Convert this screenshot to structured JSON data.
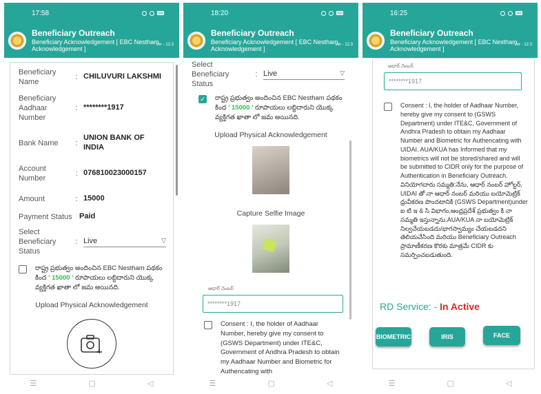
{
  "header": {
    "title": "Beneficiary Outreach",
    "subtitle_line1": "Beneficiary Acknowledgement [ EBC Nestham",
    "subtitle_line2": "Acknowledgement ]",
    "version": "Ver - 12.3"
  },
  "colors": {
    "accent": "#26a699",
    "amount": "#30c04e",
    "inactive": "#d12a2a"
  },
  "icons": [
    "status-icons",
    "camera-icon",
    "checkbox-icon",
    "dropdown-chevron-icon",
    "menu-nav-icon",
    "home-nav-icon",
    "back-nav-icon"
  ],
  "screen1": {
    "time": "17:58",
    "fields": [
      {
        "label": "Beneficiary Name",
        "value": "CHILUVURI LAKSHMI"
      },
      {
        "label": "Beneficiary Aadhaar Number",
        "value": "********1917"
      },
      {
        "label": "Bank Name",
        "value": "UNION BANK OF INDIA"
      },
      {
        "label": "Account Number",
        "value": "076810023000157"
      },
      {
        "label": "Amount",
        "value": "15000"
      },
      {
        "label": "Payment Status",
        "value": "Paid"
      }
    ],
    "select_label": "Select Beneficiary Status",
    "select_value": "Live",
    "consent_pre": "రాష్ట్ర ప్రభుత్వం అందించిన EBC Nestham పథకం కింద",
    "consent_amount": "' 15000 '",
    "consent_post": "రూపాయలు లబ్దిదారుని యొక్క వ్యక్తిగత ఖాతా లో జమ అయినది.",
    "upload_title": "Upload Physical Acknowledgement"
  },
  "screen2": {
    "time": "18:20",
    "select_label": "Select Beneficiary Status",
    "select_value": "Live",
    "consent_pre": "రాష్ట్ర ప్రభుత్వం అందించిన EBC Nestham పథకం కింద",
    "consent_amount": "' 15000 '",
    "consent_post": "రూపాయలు లబ్దిదారుని యొక్క వ్యక్తిగత ఖాతా లో జమ అయినది.",
    "upload_title": "Upload Physical Acknowledgement",
    "selfie_title": "Capture Selfie Image",
    "aadhaar_label": "ఆధార్ నెంబర్",
    "aadhaar_value": "********1917",
    "consent_en": "Consent : I, the holder of Aadhaar Number, hereby give my consent to (GSWS Department) under ITE&C, Government of Andhra Pradesh to obtain my Aadhaar Number and Biometric for Authencating with"
  },
  "screen3": {
    "time": "16:25",
    "aadhaar_label": "ఆధార్ నెంబర్",
    "aadhaar_value": "********1917",
    "consent_en": "Consent : I, the holder of Aadhaar Number, hereby give my consent to (GSWS Department) under ITE&C, Government of Andhra Pradesh to obtain my Aadhaar Number and Biometric for Authencating with UIDAI. AUA/KUA has Informed that my biometrics will not be stored/shared and will be submitted to CIDR only for the purpose of Authentication in Beneficiary Outreach.",
    "consent_te": "వినియోగదారు సమ్మతి:నేను, ఆధార్ నంబర్ హోల్డర్, UIDAI తో నా ఆధార్ నంబర్ మరియు బయోమెట్రిక్ ధ్రువీకరణ పొందటానికి (GSWS Department)under ఐ టి ఇ & సి విభాగం,ఆంధ్రప్రదేశ్ ప్రభుత్వం కి నా సమ్మతి ఇస్తున్నాను.AUA/KUA నా బయోమెట్రిక్ నిల్వచేయబడదు/భాగస్వామ్యం చేయబడదని తెలియచేసింది మరియు Beneficiary Outreach ప్రామాణీకరణ కొరకు మాత్రమే CIDR కు సమర్పించబడుతుంది.",
    "rd_label": "RD Service: - ",
    "rd_status": "In Active",
    "buttons": {
      "biometric": "BIOMETRIC",
      "iris": "IRIS",
      "face": "FACE"
    }
  },
  "nav": {
    "menu": "☰",
    "home": "▢",
    "back": "◁"
  }
}
